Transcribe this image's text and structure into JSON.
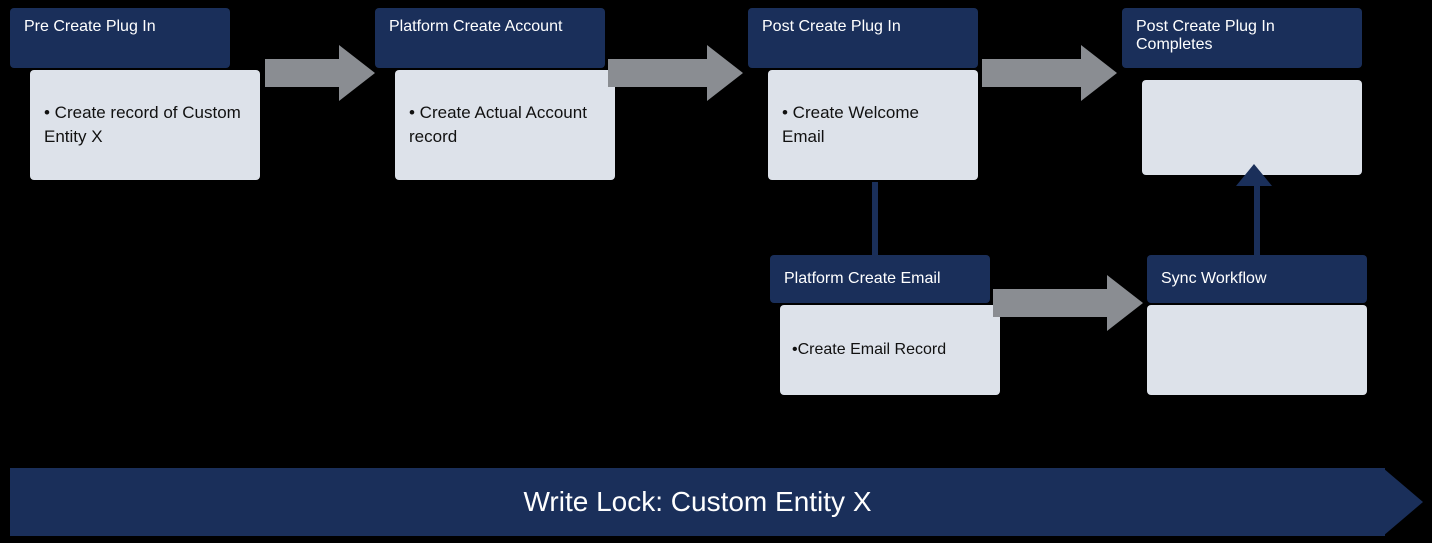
{
  "diagram": {
    "title": "Write Lock: Custom Entity X",
    "nodes": {
      "preCreate": {
        "label": "Pre Create Plug In",
        "detail": "• Create record of Custom Entity X"
      },
      "platformCreate": {
        "label": "Platform Create Account",
        "detail": "• Create Actual Account record"
      },
      "postCreatePlugIn": {
        "label": "Post Create Plug In",
        "detail": "• Create Welcome Email"
      },
      "postCreateCompletes": {
        "label": "Post Create Plug In Completes",
        "detail": ""
      },
      "platformCreateEmail": {
        "label": "Platform Create Email",
        "detail": "•Create Email Record"
      },
      "syncWorkflow": {
        "label": "Sync Workflow",
        "detail": ""
      }
    },
    "writeLock": "Write Lock: Custom Entity X"
  }
}
